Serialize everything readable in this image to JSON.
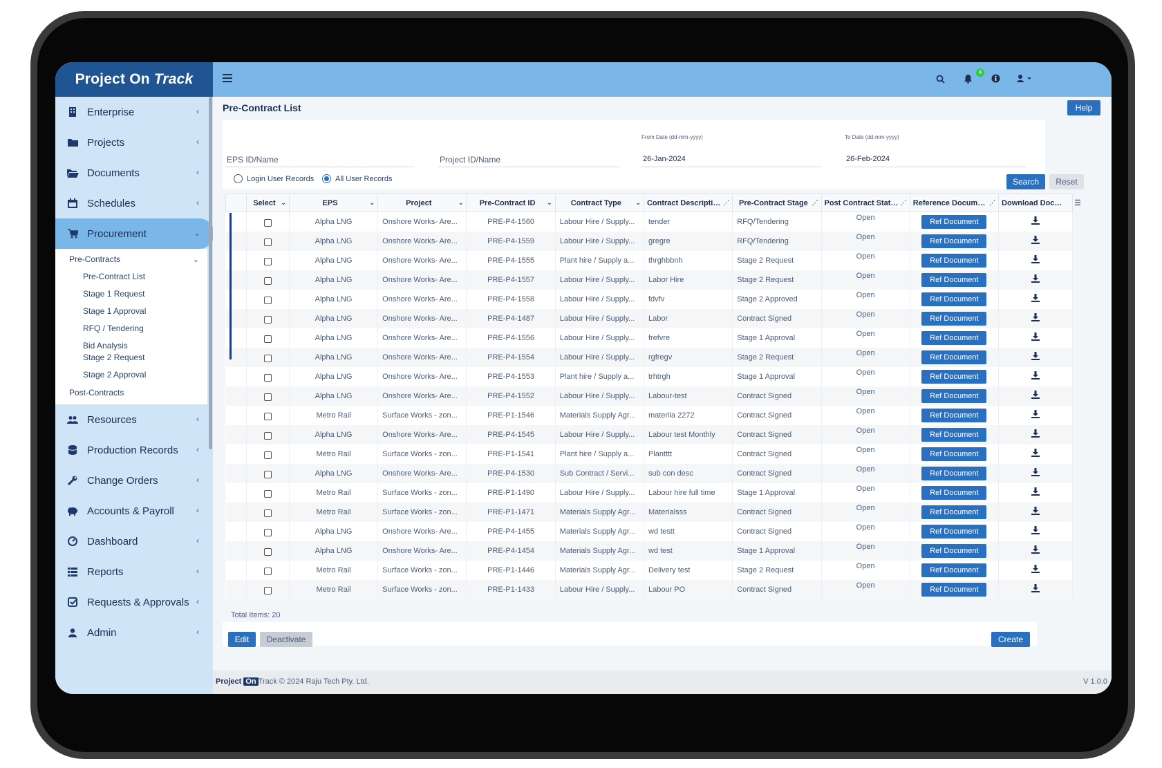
{
  "brand": {
    "name_a": "Project On",
    "name_b": "Track"
  },
  "sidebar": {
    "items_top": [
      {
        "label": "Enterprise",
        "icon": "building-icon"
      },
      {
        "label": "Projects",
        "icon": "folder-icon"
      },
      {
        "label": "Documents",
        "icon": "folder-open-icon"
      },
      {
        "label": "Schedules",
        "icon": "calendar-icon"
      },
      {
        "label": "Procurement",
        "icon": "cart-icon"
      }
    ],
    "procurement_sub": {
      "head": "Pre-Contracts",
      "items": [
        "Pre-Contract List",
        "Stage 1 Request",
        "Stage 1 Approval",
        "RFQ / Tendering",
        "Bid Analysis",
        "Stage 2 Request",
        "Stage 2 Approval"
      ],
      "post": "Post-Contracts"
    },
    "items_bottom": [
      {
        "label": "Resources",
        "icon": "users-icon"
      },
      {
        "label": "Production Records",
        "icon": "database-icon"
      },
      {
        "label": "Change Orders",
        "icon": "wrench-icon"
      },
      {
        "label": "Accounts & Payroll",
        "icon": "piggy-bank-icon"
      },
      {
        "label": "Dashboard",
        "icon": "gauge-icon"
      },
      {
        "label": "Reports",
        "icon": "list-icon"
      },
      {
        "label": "Requests & Approvals",
        "icon": "check-square-icon"
      },
      {
        "label": "Admin",
        "icon": "user-icon"
      }
    ]
  },
  "topbar": {
    "notification_count": "4"
  },
  "page": {
    "title": "Pre-Contract List",
    "help": "Help",
    "eps_placeholder": "EPS ID/Name",
    "project_placeholder": "Project ID/Name",
    "from_label": "From Date (dd-mm-yyyy)",
    "from_value": "26-Jan-2024",
    "to_label": "To Date (dd-mm-yyyy)",
    "to_value": "26-Feb-2024",
    "radio_login": "Login User Records",
    "radio_all": "All User Records",
    "search": "Search",
    "reset": "Reset",
    "total": "Total Items: 20",
    "edit": "Edit",
    "deactivate": "Deactivate",
    "create": "Create"
  },
  "table": {
    "headers": [
      "Select",
      "EPS",
      "Project",
      "Pre-Contract ID",
      "Contract Type",
      "Contract Descriptio...",
      "Pre-Contract Stage",
      "Post Contract Statu...",
      "Reference Documen...",
      "Download Docum..."
    ],
    "ref_label": "Ref Document",
    "rows": [
      [
        "Alpha LNG",
        "Onshore Works- Are...",
        "PRE-P4-1560",
        "Labour Hire / Supply...",
        "tender",
        "RFQ/Tendering",
        "Open"
      ],
      [
        "Alpha LNG",
        "Onshore Works- Are...",
        "PRE-P4-1559",
        "Labour Hire / Supply...",
        "gregre",
        "RFQ/Tendering",
        "Open"
      ],
      [
        "Alpha LNG",
        "Onshore Works- Are...",
        "PRE-P4-1555",
        "Plant hire / Supply a...",
        "thrghbbnh",
        "Stage 2 Request",
        "Open"
      ],
      [
        "Alpha LNG",
        "Onshore Works- Are...",
        "PRE-P4-1557",
        "Labour Hire / Supply...",
        "Labor Hire",
        "Stage 2 Request",
        "Open"
      ],
      [
        "Alpha LNG",
        "Onshore Works- Are...",
        "PRE-P4-1558",
        "Labour Hire / Supply...",
        "fdvfv",
        "Stage 2 Approved",
        "Open"
      ],
      [
        "Alpha LNG",
        "Onshore Works- Are...",
        "PRE-P4-1487",
        "Labour Hire / Supply...",
        "Labor",
        "Contract Signed",
        "Open"
      ],
      [
        "Alpha LNG",
        "Onshore Works- Are...",
        "PRE-P4-1556",
        "Labour Hire / Supply...",
        "frefvre",
        "Stage 1 Approval",
        "Open"
      ],
      [
        "Alpha LNG",
        "Onshore Works- Are...",
        "PRE-P4-1554",
        "Labour Hire / Supply...",
        "rgfregv",
        "Stage 2 Request",
        "Open"
      ],
      [
        "Alpha LNG",
        "Onshore Works- Are...",
        "PRE-P4-1553",
        "Plant hire / Supply a...",
        "trhtrgh",
        "Stage 1 Approval",
        "Open"
      ],
      [
        "Alpha LNG",
        "Onshore Works- Are...",
        "PRE-P4-1552",
        "Labour Hire / Supply...",
        "Labour-test",
        "Contract Signed",
        "Open"
      ],
      [
        "Metro Rail",
        "Surface Works - zon...",
        "PRE-P1-1546",
        "Materials Supply Agr...",
        "materila 2272",
        "Contract Signed",
        "Open"
      ],
      [
        "Alpha LNG",
        "Onshore Works- Are...",
        "PRE-P4-1545",
        "Labour Hire / Supply...",
        "Labour test Monthly",
        "Contract Signed",
        "Open"
      ],
      [
        "Metro Rail",
        "Surface Works - zon...",
        "PRE-P1-1541",
        "Plant hire / Supply a...",
        "Plantttt",
        "Contract Signed",
        "Open"
      ],
      [
        "Alpha LNG",
        "Onshore Works- Are...",
        "PRE-P4-1530",
        "Sub Contract / Servi...",
        "sub con desc",
        "Contract Signed",
        "Open"
      ],
      [
        "Metro Rail",
        "Surface Works - zon...",
        "PRE-P1-1490",
        "Labour Hire / Supply...",
        "Labour hire full time",
        "Stage 1 Approval",
        "Open"
      ],
      [
        "Metro Rail",
        "Surface Works - zon...",
        "PRE-P1-1471",
        "Materials Supply Agr...",
        "Materialsss",
        "Contract Signed",
        "Open"
      ],
      [
        "Alpha LNG",
        "Onshore Works- Are...",
        "PRE-P4-1455",
        "Materials Supply Agr...",
        "wd testt",
        "Contract Signed",
        "Open"
      ],
      [
        "Alpha LNG",
        "Onshore Works- Are...",
        "PRE-P4-1454",
        "Materials Supply Agr...",
        "wd test",
        "Stage 1 Approval",
        "Open"
      ],
      [
        "Metro Rail",
        "Surface Works - zon...",
        "PRE-P1-1446",
        "Materials Supply Agr...",
        "Delivery test",
        "Stage 2 Request",
        "Open"
      ],
      [
        "Metro Rail",
        "Surface Works - zon...",
        "PRE-P1-1433",
        "Labour Hire / Supply...",
        "Labour PO",
        "Contract Signed",
        "Open"
      ]
    ]
  },
  "footer": {
    "p1": "Project",
    "p2": "On",
    "p3": "Track",
    "copy": "© 2024 Raju Tech Pty. Ltd.",
    "version": "V 1.0.0"
  }
}
